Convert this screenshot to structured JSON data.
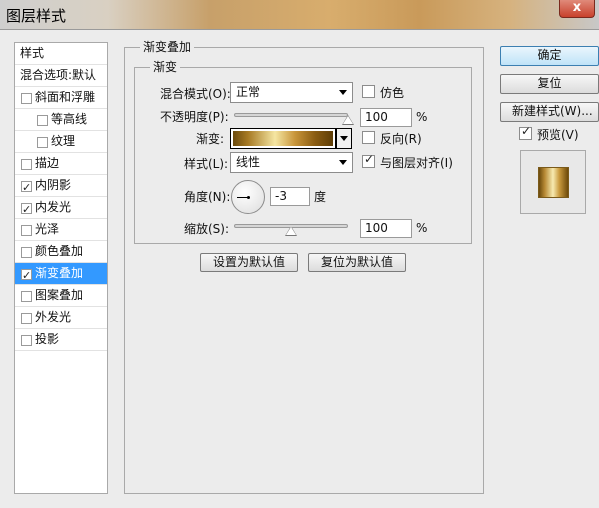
{
  "window": {
    "title": "图层样式",
    "close_label": "x"
  },
  "style_list": {
    "header_styles": "样式",
    "header_blending": "混合选项:默认",
    "items": [
      {
        "label": "斜面和浮雕",
        "checked": false,
        "indent": 0
      },
      {
        "label": "等高线",
        "checked": false,
        "indent": 1
      },
      {
        "label": "纹理",
        "checked": false,
        "indent": 1
      },
      {
        "label": "描边",
        "checked": false,
        "indent": 0
      },
      {
        "label": "内阴影",
        "checked": true,
        "indent": 0
      },
      {
        "label": "内发光",
        "checked": true,
        "indent": 0
      },
      {
        "label": "光泽",
        "checked": false,
        "indent": 0
      },
      {
        "label": "颜色叠加",
        "checked": false,
        "indent": 0
      },
      {
        "label": "渐变叠加",
        "checked": true,
        "indent": 0,
        "selected": true
      },
      {
        "label": "图案叠加",
        "checked": false,
        "indent": 0
      },
      {
        "label": "外发光",
        "checked": false,
        "indent": 0
      },
      {
        "label": "投影",
        "checked": false,
        "indent": 0
      }
    ]
  },
  "panel": {
    "outer_title": "渐变叠加",
    "inner_title": "渐变",
    "blend_mode_label": "混合模式(O):",
    "blend_mode_value": "正常",
    "dither_label": "仿色",
    "dither_checked": false,
    "opacity_label": "不透明度(P):",
    "opacity_value": "100",
    "opacity_unit": "%",
    "opacity_level": 1.0,
    "gradient_label": "渐变:",
    "reverse_label": "反向(R)",
    "reverse_checked": false,
    "style_label": "样式(L):",
    "style_value": "线性",
    "align_label": "与图层对齐(I)",
    "align_checked": true,
    "angle_label": "角度(N):",
    "angle_value": "-3",
    "angle_unit": "度",
    "scale_label": "缩放(S):",
    "scale_value": "100",
    "scale_unit": "%",
    "scale_level": 0.5,
    "make_default_label": "设置为默认值",
    "reset_default_label": "复位为默认值"
  },
  "side_buttons": {
    "ok_label": "确定",
    "reset_label": "复位",
    "new_style_label": "新建样式(W)...",
    "preview_label": "预览(V)",
    "preview_checked": true
  },
  "colors": {
    "selection": "#3399ff",
    "gradient_dark": "#6b4a0c",
    "gradient_light": "#f5e6a2"
  }
}
